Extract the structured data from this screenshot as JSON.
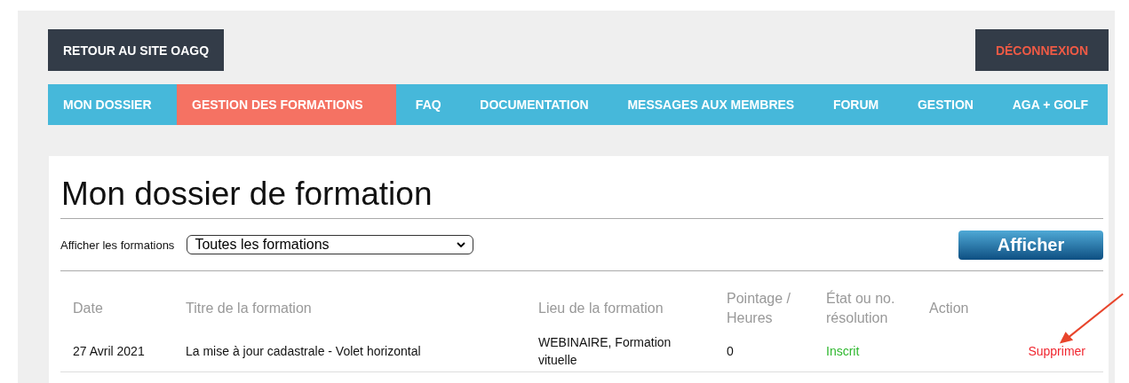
{
  "top_buttons": {
    "back": "RETOUR AU SITE OAGQ",
    "logout": "DÉCONNEXION"
  },
  "nav": [
    {
      "label": "MON DOSSIER",
      "selected": false
    },
    {
      "label": "GESTION DES FORMATIONS",
      "selected": true
    },
    {
      "label": "FAQ",
      "selected": false
    },
    {
      "label": "DOCUMENTATION",
      "selected": false
    },
    {
      "label": "MESSAGES AUX MEMBRES",
      "selected": false
    },
    {
      "label": "FORUM",
      "selected": false
    },
    {
      "label": "GESTION",
      "selected": false
    },
    {
      "label": "AGA + GOLF",
      "selected": false
    }
  ],
  "page_title": "Mon dossier de formation",
  "filter": {
    "label": "Afficher les formations",
    "value": "Toutes les formations",
    "button": "Afficher"
  },
  "table": {
    "columns": [
      "Date",
      "Titre de la formation",
      "Lieu de la formation",
      "Pointage / Heures",
      "État ou no. résolution",
      "Action"
    ],
    "rows": [
      {
        "date": "27 Avril 2021",
        "title": "La mise à jour cadastrale - Volet horizontal",
        "place": "WEBINAIRE, Formation vituelle",
        "hours": "0",
        "status": "Inscrit",
        "action": "Supprimer"
      }
    ]
  },
  "annotation": {
    "kind": "arrow"
  }
}
